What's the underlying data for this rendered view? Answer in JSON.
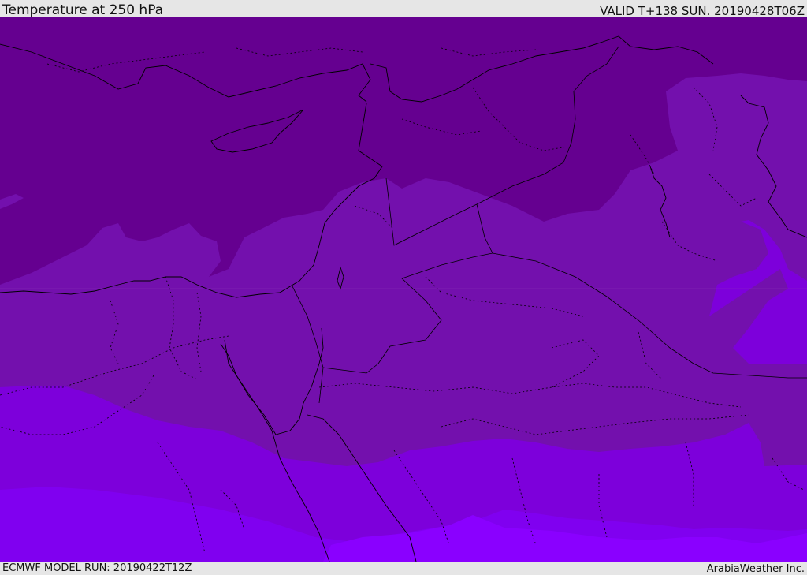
{
  "header": {
    "title": "Temperature at 250 hPa",
    "valid_time": "VALID T+138 SUN. 20190428T06Z"
  },
  "footer": {
    "model_run": "ECMWF MODEL RUN: 20190422T12Z",
    "credit": "ArabiaWeather Inc."
  },
  "map": {
    "field": "temperature",
    "level": "250 hPa",
    "colors": {
      "coldest": "#650090",
      "cold": "#7310ad",
      "mid": "#7d00db",
      "warm": "#8000f0",
      "warmest": "#8a00ff",
      "boundary": "#000000"
    }
  }
}
